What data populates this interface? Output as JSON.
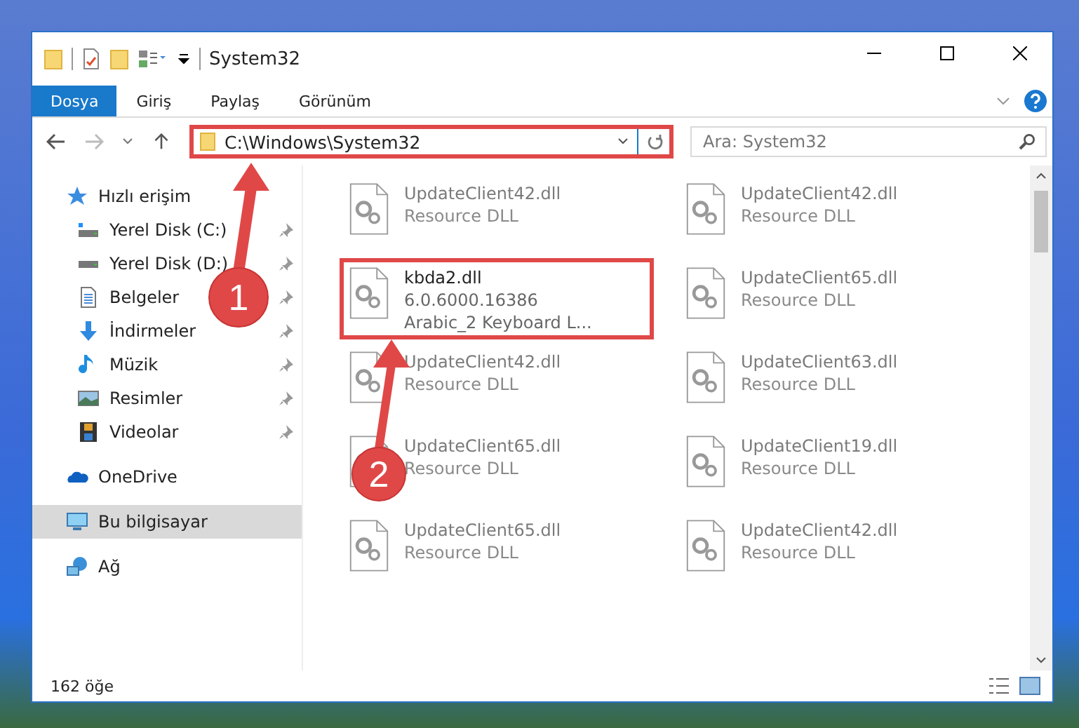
{
  "window": {
    "title": "System32"
  },
  "ribbon_tabs": [
    {
      "label": "Dosya",
      "selected": true
    },
    {
      "label": "Giriş",
      "selected": false
    },
    {
      "label": "Paylaş",
      "selected": false
    },
    {
      "label": "Görünüm",
      "selected": false
    }
  ],
  "address_bar": {
    "value": "C:\\Windows\\System32",
    "highlighted": true
  },
  "search": {
    "placeholder": "Ara: System32"
  },
  "sidebar": {
    "items": [
      {
        "label": "Hızlı erişim",
        "selected": false,
        "children": [
          {
            "label": "Yerel Disk (C:)",
            "pinned": true,
            "selected": false
          },
          {
            "label": "Yerel Disk (D:)",
            "pinned": true,
            "selected": false
          },
          {
            "label": "Belgeler",
            "pinned": true,
            "selected": false
          },
          {
            "label": "İndirmeler",
            "pinned": true,
            "selected": false
          },
          {
            "label": "Müzik",
            "pinned": true,
            "selected": false
          },
          {
            "label": "Resimler",
            "pinned": true,
            "selected": false
          },
          {
            "label": "Videolar",
            "pinned": true,
            "selected": false
          }
        ]
      },
      {
        "label": "OneDrive",
        "selected": false
      },
      {
        "label": "Bu bilgisayar",
        "selected": true
      },
      {
        "label": "Ağ",
        "selected": false
      }
    ]
  },
  "files": [
    {
      "name": "UpdateClient42.dll",
      "lines": [
        "Resource DLL"
      ],
      "blurred": true,
      "highlighted": false
    },
    {
      "name": "UpdateClient42.dll",
      "lines": [
        "Resource DLL"
      ],
      "blurred": true,
      "highlighted": false
    },
    {
      "name": "kbda2.dll",
      "lines": [
        "6.0.6000.16386",
        "Arabic_2 Keyboard L..."
      ],
      "blurred": false,
      "highlighted": true
    },
    {
      "name": "UpdateClient65.dll",
      "lines": [
        "Resource DLL"
      ],
      "blurred": true,
      "highlighted": false
    },
    {
      "name": "UpdateClient42.dll",
      "lines": [
        "Resource DLL"
      ],
      "blurred": true,
      "highlighted": false
    },
    {
      "name": "UpdateClient63.dll",
      "lines": [
        "Resource DLL"
      ],
      "blurred": true,
      "highlighted": false
    },
    {
      "name": "UpdateClient65.dll",
      "lines": [
        "Resource DLL"
      ],
      "blurred": true,
      "highlighted": false
    },
    {
      "name": "UpdateClient19.dll",
      "lines": [
        "Resource DLL"
      ],
      "blurred": true,
      "highlighted": false
    },
    {
      "name": "UpdateClient65.dll",
      "lines": [
        "Resource DLL"
      ],
      "blurred": true,
      "highlighted": false
    },
    {
      "name": "UpdateClient42.dll",
      "lines": [
        "Resource DLL"
      ],
      "blurred": true,
      "highlighted": false
    }
  ],
  "status_bar": {
    "count": "162 öğe"
  },
  "annotations": [
    {
      "label": "1"
    },
    {
      "label": "2"
    }
  ]
}
